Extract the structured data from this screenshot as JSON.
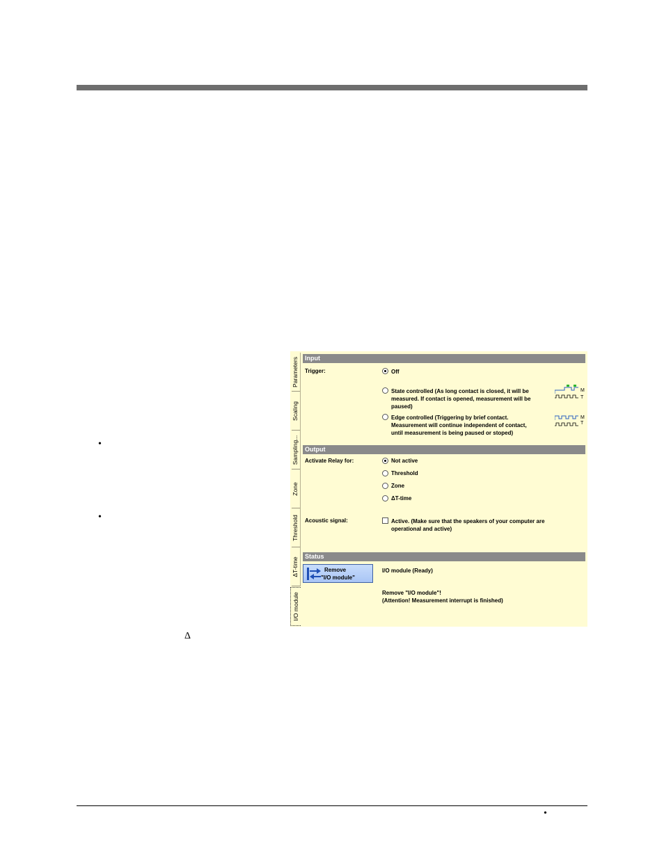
{
  "page": {
    "bullet_mark": "•",
    "delta_mark": "Δ"
  },
  "panel": {
    "tabs": [
      {
        "label": "Parameters"
      },
      {
        "label": "Scaling"
      },
      {
        "label": "Sampling..."
      },
      {
        "label": "Zone"
      },
      {
        "label": "Threshold"
      },
      {
        "label": "ΔT-time"
      },
      {
        "label": "I/O module"
      }
    ],
    "input": {
      "title": "Input",
      "trigger_label": "Trigger:",
      "options": [
        {
          "text": "Off",
          "selected": true
        },
        {
          "text_lines": [
            "State controlled (As long contact is closed, it will be",
            "measured. If contact is opened, measurement will be",
            "paused)"
          ],
          "selected": false
        },
        {
          "text_lines": [
            "Edge controlled (Triggering by brief contact.",
            "Measurement will continue independent of contact,",
            "until measurement is being paused or stoped)"
          ],
          "selected": false
        }
      ],
      "wave_labels": {
        "m": "M",
        "t": "T"
      }
    },
    "output": {
      "title": "Output",
      "relay_label": "Activate Relay for:",
      "relay_options": [
        {
          "text": "Not active",
          "selected": true
        },
        {
          "text": "Threshold",
          "selected": false
        },
        {
          "text": "Zone",
          "selected": false
        },
        {
          "text": "ΔT-time",
          "selected": false
        }
      ],
      "acoustic_label": "Acoustic signal:",
      "acoustic_lines": [
        "Active. (Make sure that the speakers of your computer are",
        "operational and active)"
      ],
      "acoustic_checked": false
    },
    "status": {
      "title": "Status",
      "button_line1": "Remove",
      "button_line2": "\"I/O module\"",
      "module_state": "I/O module (Ready)",
      "message_lines": [
        "Remove  \"I/O module\"!",
        "(Attention! Measurement interrupt is finished)"
      ]
    }
  },
  "colors": {
    "panel_bg": "#fffcd3",
    "section_bar": "#8a8a8a",
    "button_fill": "#b8d0f8",
    "wave_green": "#2db52d",
    "wave_blue": "#2a5fbf"
  }
}
